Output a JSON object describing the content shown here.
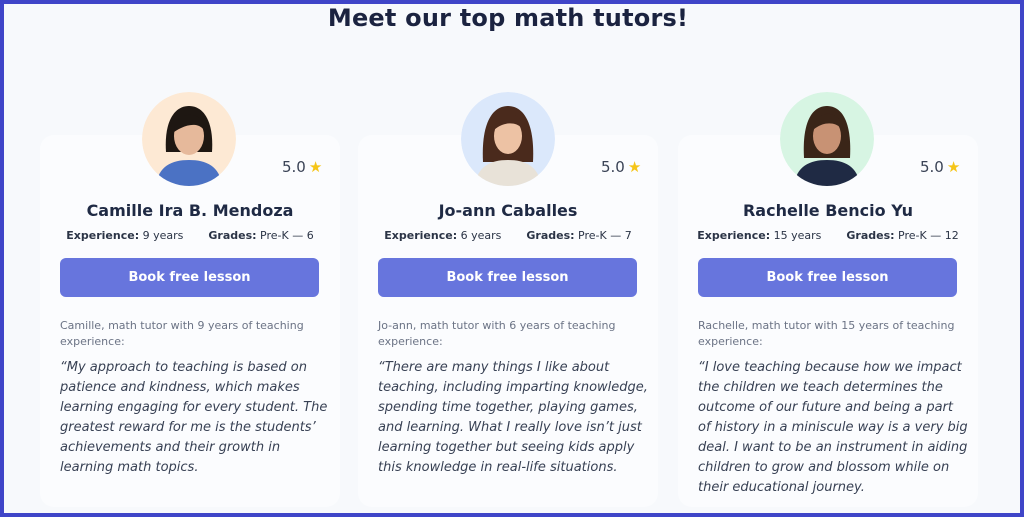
{
  "page": {
    "title": "Meet our top math tutors!",
    "accent_color": "#6775dd",
    "border_color": "#3f45c8",
    "star_color": "#f5c518"
  },
  "tutors": [
    {
      "name": "Camille Ira B. Mendoza",
      "rating": "5.0",
      "star_icon": "star-icon",
      "experience_label": "Experience:",
      "experience_value": "9 years",
      "grades_label": "Grades:",
      "grades_value": "Pre-K — 6",
      "button_label": "Book free lesson",
      "intro": "Camille, math tutor with 9 years of teaching experience:",
      "quote": "“My approach to teaching is based on patience and kindness, which makes learning engaging for every student. The greatest reward for me is the students’ achievements and their growth in learning math topics.",
      "avatar_bg": "#fde9d4"
    },
    {
      "name": "Jo-ann Caballes",
      "rating": "5.0",
      "star_icon": "star-icon",
      "experience_label": "Experience:",
      "experience_value": "6 years",
      "grades_label": "Grades:",
      "grades_value": "Pre-K — 7",
      "button_label": "Book free lesson",
      "intro": "Jo-ann, math tutor with 6 years of teaching experience:",
      "quote": "“There are many things I like about teaching, including imparting knowledge, spending time together, playing games, and learning. What I really love isn’t just learning together but seeing kids apply this knowledge in real-life situations.",
      "avatar_bg": "#dbe8fb"
    },
    {
      "name": "Rachelle Bencio Yu",
      "rating": "5.0",
      "star_icon": "star-icon",
      "experience_label": "Experience:",
      "experience_value": "15 years",
      "grades_label": "Grades:",
      "grades_value": "Pre-K — 12",
      "button_label": "Book free lesson",
      "intro": "Rachelle, math tutor with 15 years of teaching experience:",
      "quote": "“I love teaching because how we impact the children we teach determines the outcome of our future and being a part of history in a miniscule way is a very big deal. I want to be an instrument in aiding children to grow and blossom while on their educational journey.",
      "avatar_bg": "#d7f5e3"
    }
  ]
}
